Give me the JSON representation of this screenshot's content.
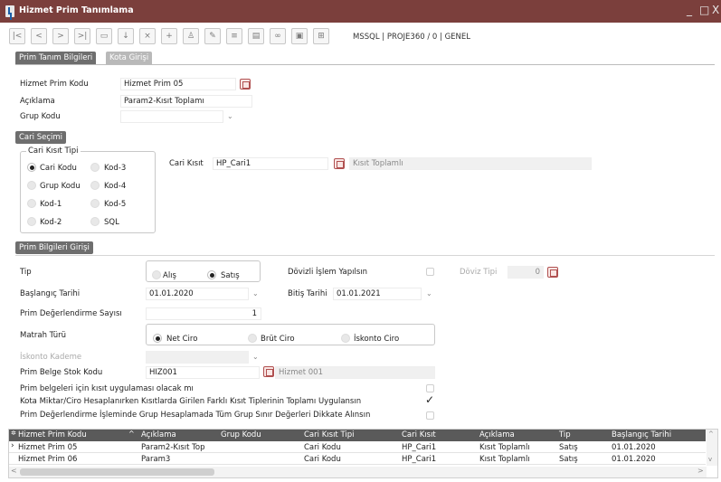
{
  "window": {
    "title": "Hizmet Prim Tanımlama",
    "controls": [
      "_",
      "□",
      "X"
    ]
  },
  "toolbar": {
    "icons": [
      "first-icon",
      "prev-icon",
      "next-icon",
      "last-icon",
      "save-icon",
      "download-icon",
      "cancel-icon",
      "add-icon",
      "user-icon",
      "edit-icon",
      "print-icon",
      "document-icon",
      "link-icon",
      "lock-icon",
      "grid-icon"
    ],
    "info": "MSSQL | PROJE360 / 0 | GENEL"
  },
  "tabs": {
    "t1": "Prim Tanım Bilgileri",
    "t2": "Kota Girişi"
  },
  "form": {
    "kod_label": "Hizmet Prim Kodu",
    "kod_value": "Hizmet Prim 05",
    "aciklama_label": "Açıklama",
    "aciklama_value": "Param2-Kısıt Toplamı",
    "grup_label": "Grup Kodu",
    "grup_value": ""
  },
  "cari": {
    "section": "Cari Seçimi",
    "group_title": "Cari Kısıt Tipi",
    "options": [
      "Cari Kodu",
      "Kod-3",
      "Grup Kodu",
      "Kod-4",
      "Kod-1",
      "Kod-5",
      "Kod-2",
      "SQL"
    ],
    "selected": "Cari Kodu",
    "kisit_label": "Cari Kısıt",
    "kisit_value": "HP_Cari1",
    "kisit_desc": "Kısıt Toplamlı"
  },
  "prim": {
    "section": "Prim Bilgileri Girişi",
    "tip_label": "Tip",
    "tip_alis": "Alış",
    "tip_satis": "Satış",
    "tip_selected": "Satış",
    "dovizli_label": "Dövizli İşlem Yapılsın",
    "doviz_tipi_label": "Döviz Tipi",
    "doviz_tipi_value": "0",
    "baslangic_label": "Başlangıç Tarihi",
    "baslangic_value": "01.01.2020",
    "bitis_label": "Bitiş Tarihi",
    "bitis_value": "01.01.2021",
    "deger_sayisi_label": "Prim Değerlendirme Sayısı",
    "deger_sayisi_value": "1",
    "matrah_label": "Matrah Türü",
    "matrah_net": "Net Ciro",
    "matrah_brut": "Brüt Ciro",
    "matrah_iskonto": "İskonto Ciro",
    "matrah_selected": "Net Ciro",
    "iskonto_kademe_label": "İskonto Kademe",
    "iskonto_kademe_value": "",
    "stok_label": "Prim Belge Stok Kodu",
    "stok_value": "HIZ001",
    "stok_desc": "Hizmet 001",
    "check1_label": "Prim belgeleri için kısıt uygulaması olacak mı",
    "check2_label": "Kota Miktar/Ciro Hesaplanırken Kısıtlarda Girilen Farklı Kısıt Tiplerinin Toplamı Uygulansın",
    "check3_label": "Prim Değerlendirme İşleminde Grup Hesaplamada Tüm Grup Sınır Değerleri Dikkate Alınsın",
    "check1": false,
    "check2": true,
    "check3": false
  },
  "grid": {
    "columns": [
      "Hizmet Prim Kodu",
      "Açıklama",
      "Grup Kodu",
      "Cari Kısıt Tipi",
      "Cari Kısıt",
      "Açıklama",
      "Tip",
      "Başlangıç Tarihi"
    ],
    "rows": [
      [
        "Hizmet Prim 05",
        "Param2-Kısıt Top",
        "",
        "Cari Kodu",
        "HP_Cari1",
        "Kısıt Toplamlı",
        "Satış",
        "01.01.2020"
      ],
      [
        "Hizmet Prim 06",
        "Param3",
        "",
        "Cari Kodu",
        "HP_Cari1",
        "Kısıt Toplamlı",
        "Satış",
        "01.01.2020"
      ]
    ]
  },
  "colors": {
    "titlebar": "#7b3f3c",
    "section": "#6e6e6e",
    "grid_header": "#5a5a5a",
    "lookup": "#b05050"
  }
}
